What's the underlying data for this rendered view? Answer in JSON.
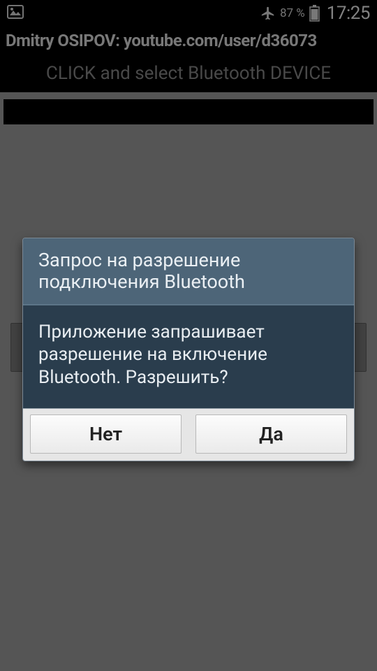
{
  "status": {
    "battery_pct": "87 %",
    "time": "17:25"
  },
  "title_bar": "Dmitry OSIPOV: youtube.com/user/d36073",
  "instruction": "CLICK and select Bluetooth DEVICE",
  "dialog": {
    "title": "Запрос на разрешение подключения Bluetooth",
    "message": "Приложение запрашивает разрешение на включение Bluetooth. Разрешить?",
    "no": "Нет",
    "yes": "Да"
  }
}
